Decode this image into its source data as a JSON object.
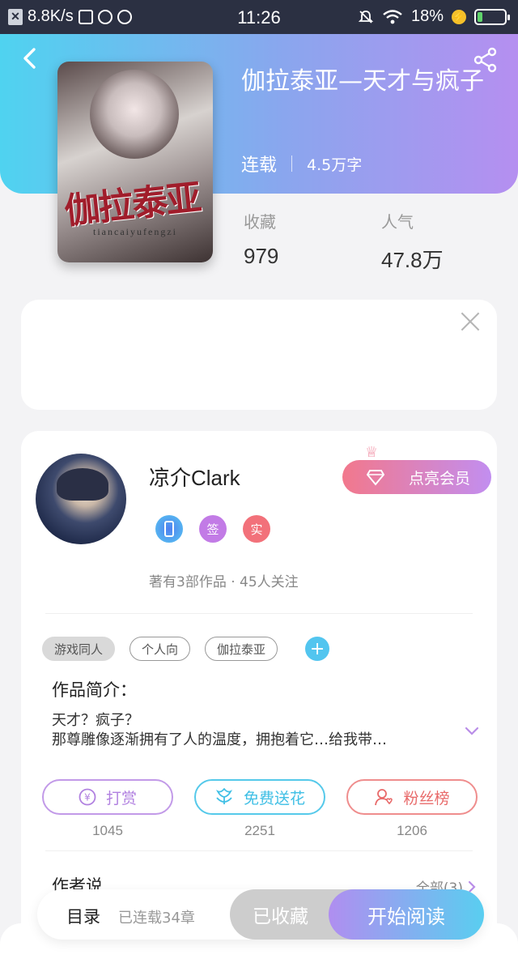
{
  "status_bar": {
    "network_speed": "8.8K/s",
    "time": "11:26",
    "battery": "18%",
    "battery_level": 0.18
  },
  "header": {
    "back_icon": "chevron-left-icon",
    "share_icon": "share-icon"
  },
  "book": {
    "title": "伽拉泰亚—天才与疯子",
    "status": "连载",
    "word_count": "4.5万字",
    "cover_title": "伽拉泰亚",
    "cover_subtitle": "tiancaiyufengzi",
    "stats": [
      {
        "label": "收藏",
        "value": "979"
      },
      {
        "label": "人气",
        "value": "47.8万"
      }
    ]
  },
  "author": {
    "name": "凉介Clark",
    "vip_button": "点亮会员",
    "badges": [
      {
        "icon": "phone-icon",
        "text": ""
      },
      {
        "icon": "signed-icon",
        "text": "签"
      },
      {
        "icon": "verified-icon",
        "text": "实"
      }
    ],
    "summary": "著有3部作品 · 45人关注"
  },
  "tags": [
    "游戏同人",
    "个人向",
    "伽拉泰亚"
  ],
  "intro": {
    "title": "作品简介：",
    "lines": [
      "天才？疯子？",
      "那尊雕像逐渐拥有了人的温度，拥抱着它…给我带…"
    ]
  },
  "actions": [
    {
      "label": "打赏",
      "icon": "yen-icon",
      "count": "1045"
    },
    {
      "label": "免费送花",
      "icon": "flower-icon",
      "count": "2251"
    },
    {
      "label": "粉丝榜",
      "icon": "fans-icon",
      "count": "1206"
    }
  ],
  "author_say": {
    "title": "作者说",
    "all_label": "全部(3)"
  },
  "bottom_bar": {
    "toc_label": "目录",
    "toc_sub": "已连载34章",
    "fav_label": "已收藏",
    "read_label": "开始阅读"
  },
  "colors": {
    "status_bar": "#2b3042",
    "hero_start": "#4fd3f0",
    "hero_end": "#b58ff0",
    "accent_blue": "#52c5ef",
    "accent_purple": "#b08ef0",
    "accent_pink": "#f2788c"
  }
}
